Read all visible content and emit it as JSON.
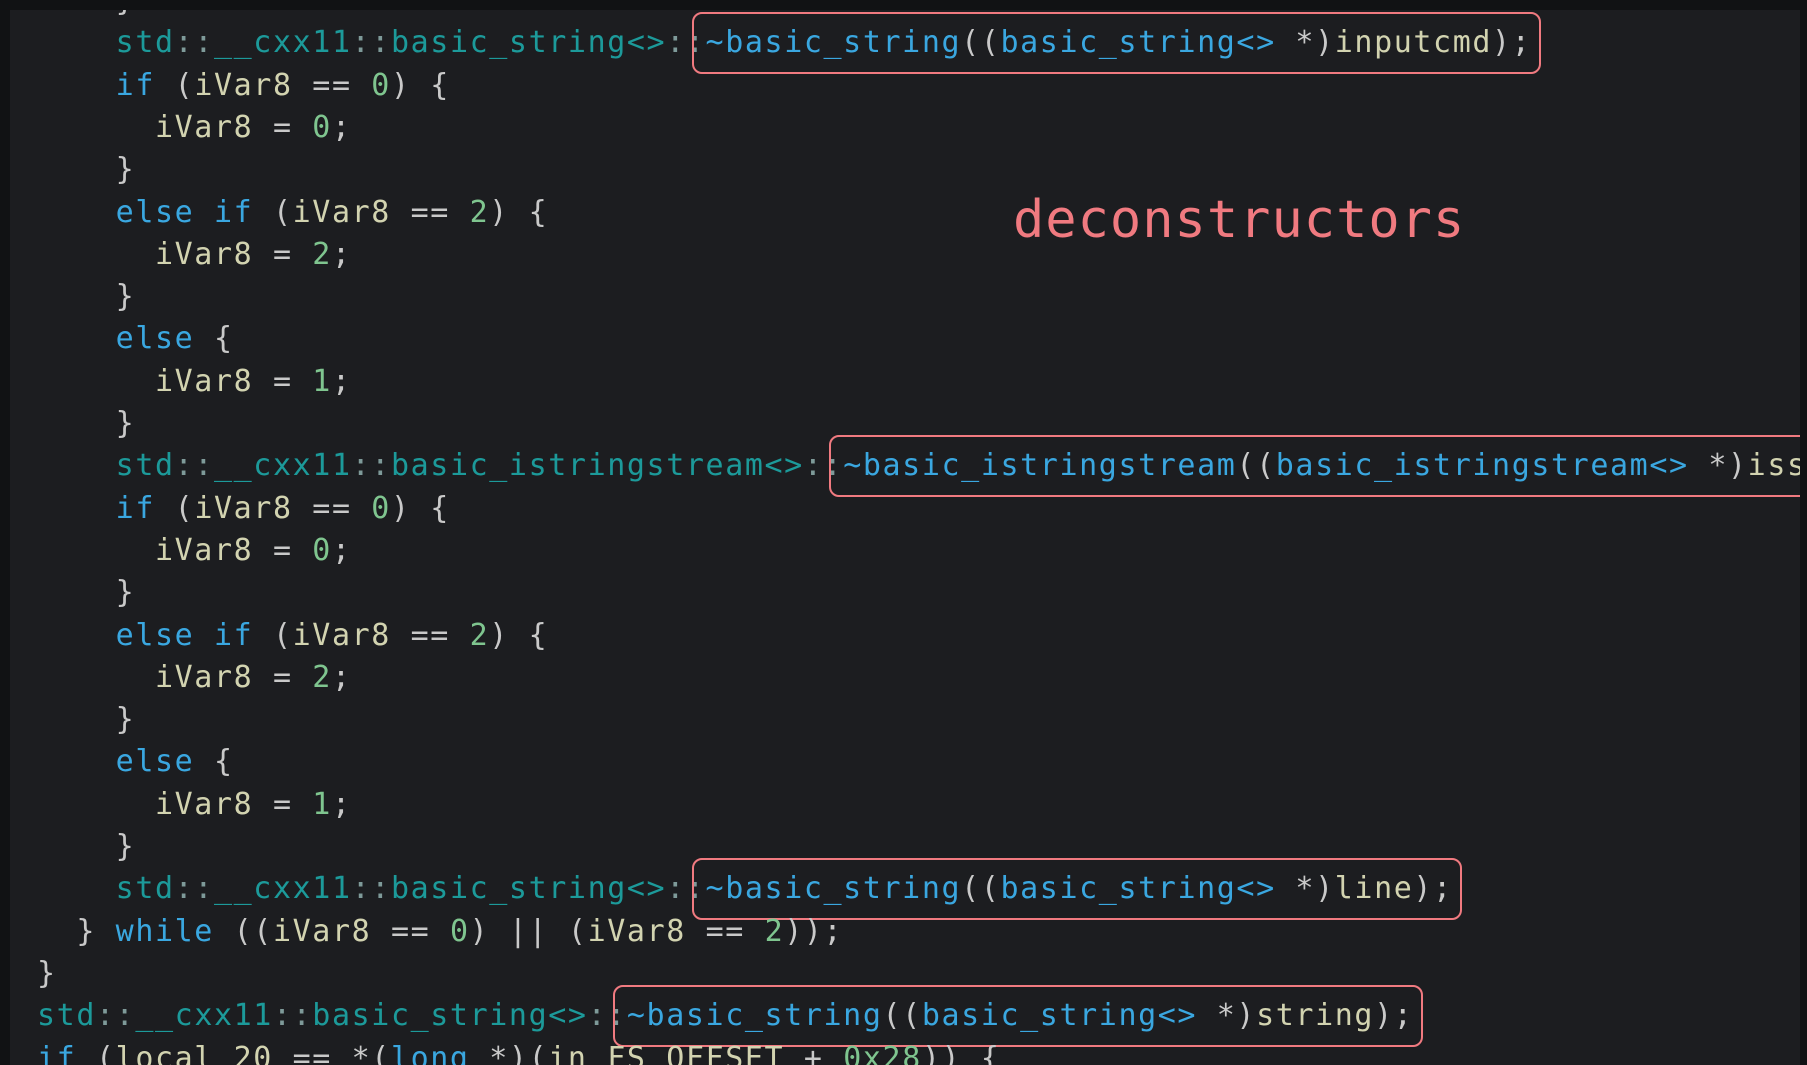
{
  "annotation": "deconstructors",
  "colors": {
    "background": "#1c1d20",
    "keyword": "#3aa7e0",
    "identifier": "#d2d3b0",
    "number": "#7fc58f",
    "class": "#1c9a9a",
    "highlight": "#f07a80"
  },
  "lines": [
    {
      "indent": "    ",
      "tokens": [
        {
          "t": "}",
          "c": "p"
        }
      ]
    },
    {
      "indent": "    ",
      "hl": true,
      "tokens": [
        {
          "t": "std",
          "c": "cls"
        },
        {
          "t": "::",
          "c": "op"
        },
        {
          "t": "__cxx11",
          "c": "cls"
        },
        {
          "t": "::",
          "c": "op"
        },
        {
          "t": "basic_string<>",
          "c": "cls"
        },
        {
          "t": "::",
          "c": "op"
        },
        {
          "t": "~basic_string",
          "c": "kw"
        },
        {
          "t": "((",
          "c": "p"
        },
        {
          "t": "basic_string<>",
          "c": "kw"
        },
        {
          "t": " *)",
          "c": "p"
        },
        {
          "t": "inputcmd",
          "c": "id"
        },
        {
          "t": ");",
          "c": "p"
        }
      ]
    },
    {
      "indent": "    ",
      "tokens": [
        {
          "t": "if",
          "c": "kw"
        },
        {
          "t": " (",
          "c": "p"
        },
        {
          "t": "iVar8",
          "c": "id"
        },
        {
          "t": " == ",
          "c": "p"
        },
        {
          "t": "0",
          "c": "num"
        },
        {
          "t": ") {",
          "c": "p"
        }
      ]
    },
    {
      "indent": "      ",
      "tokens": [
        {
          "t": "iVar8",
          "c": "id"
        },
        {
          "t": " = ",
          "c": "p"
        },
        {
          "t": "0",
          "c": "num"
        },
        {
          "t": ";",
          "c": "p"
        }
      ]
    },
    {
      "indent": "    ",
      "tokens": [
        {
          "t": "}",
          "c": "p"
        }
      ]
    },
    {
      "indent": "    ",
      "tokens": [
        {
          "t": "else if",
          "c": "kw"
        },
        {
          "t": " (",
          "c": "p"
        },
        {
          "t": "iVar8",
          "c": "id"
        },
        {
          "t": " == ",
          "c": "p"
        },
        {
          "t": "2",
          "c": "num"
        },
        {
          "t": ") {",
          "c": "p"
        }
      ]
    },
    {
      "indent": "      ",
      "tokens": [
        {
          "t": "iVar8",
          "c": "id"
        },
        {
          "t": " = ",
          "c": "p"
        },
        {
          "t": "2",
          "c": "num"
        },
        {
          "t": ";",
          "c": "p"
        }
      ]
    },
    {
      "indent": "    ",
      "tokens": [
        {
          "t": "}",
          "c": "p"
        }
      ]
    },
    {
      "indent": "    ",
      "tokens": [
        {
          "t": "else",
          "c": "kw"
        },
        {
          "t": " {",
          "c": "p"
        }
      ]
    },
    {
      "indent": "      ",
      "tokens": [
        {
          "t": "iVar8",
          "c": "id"
        },
        {
          "t": " = ",
          "c": "p"
        },
        {
          "t": "1",
          "c": "num"
        },
        {
          "t": ";",
          "c": "p"
        }
      ]
    },
    {
      "indent": "    ",
      "tokens": [
        {
          "t": "}",
          "c": "p"
        }
      ]
    },
    {
      "indent": "    ",
      "hl": true,
      "tokens": [
        {
          "t": "std",
          "c": "cls"
        },
        {
          "t": "::",
          "c": "op"
        },
        {
          "t": "__cxx11",
          "c": "cls"
        },
        {
          "t": "::",
          "c": "op"
        },
        {
          "t": "basic_istringstream<>",
          "c": "cls"
        },
        {
          "t": "::",
          "c": "op"
        },
        {
          "t": "~basic_istringstream",
          "c": "kw"
        },
        {
          "t": "((",
          "c": "p"
        },
        {
          "t": "basic_istringstream<>",
          "c": "kw"
        },
        {
          "t": " *)",
          "c": "p"
        },
        {
          "t": "iss",
          "c": "id"
        },
        {
          "t": ");",
          "c": "p"
        }
      ]
    },
    {
      "indent": "    ",
      "tokens": [
        {
          "t": "if",
          "c": "kw"
        },
        {
          "t": " (",
          "c": "p"
        },
        {
          "t": "iVar8",
          "c": "id"
        },
        {
          "t": " == ",
          "c": "p"
        },
        {
          "t": "0",
          "c": "num"
        },
        {
          "t": ") {",
          "c": "p"
        }
      ]
    },
    {
      "indent": "      ",
      "tokens": [
        {
          "t": "iVar8",
          "c": "id"
        },
        {
          "t": " = ",
          "c": "p"
        },
        {
          "t": "0",
          "c": "num"
        },
        {
          "t": ";",
          "c": "p"
        }
      ]
    },
    {
      "indent": "    ",
      "tokens": [
        {
          "t": "}",
          "c": "p"
        }
      ]
    },
    {
      "indent": "    ",
      "tokens": [
        {
          "t": "else if",
          "c": "kw"
        },
        {
          "t": " (",
          "c": "p"
        },
        {
          "t": "iVar8",
          "c": "id"
        },
        {
          "t": " == ",
          "c": "p"
        },
        {
          "t": "2",
          "c": "num"
        },
        {
          "t": ") {",
          "c": "p"
        }
      ]
    },
    {
      "indent": "      ",
      "tokens": [
        {
          "t": "iVar8",
          "c": "id"
        },
        {
          "t": " = ",
          "c": "p"
        },
        {
          "t": "2",
          "c": "num"
        },
        {
          "t": ";",
          "c": "p"
        }
      ]
    },
    {
      "indent": "    ",
      "tokens": [
        {
          "t": "}",
          "c": "p"
        }
      ]
    },
    {
      "indent": "    ",
      "tokens": [
        {
          "t": "else",
          "c": "kw"
        },
        {
          "t": " {",
          "c": "p"
        }
      ]
    },
    {
      "indent": "      ",
      "tokens": [
        {
          "t": "iVar8",
          "c": "id"
        },
        {
          "t": " = ",
          "c": "p"
        },
        {
          "t": "1",
          "c": "num"
        },
        {
          "t": ";",
          "c": "p"
        }
      ]
    },
    {
      "indent": "    ",
      "tokens": [
        {
          "t": "}",
          "c": "p"
        }
      ]
    },
    {
      "indent": "    ",
      "hl": true,
      "tokens": [
        {
          "t": "std",
          "c": "cls"
        },
        {
          "t": "::",
          "c": "op"
        },
        {
          "t": "__cxx11",
          "c": "cls"
        },
        {
          "t": "::",
          "c": "op"
        },
        {
          "t": "basic_string<>",
          "c": "cls"
        },
        {
          "t": "::",
          "c": "op"
        },
        {
          "t": "~basic_string",
          "c": "kw"
        },
        {
          "t": "((",
          "c": "p"
        },
        {
          "t": "basic_string<>",
          "c": "kw"
        },
        {
          "t": " *)",
          "c": "p"
        },
        {
          "t": "line",
          "c": "id"
        },
        {
          "t": ");",
          "c": "p"
        }
      ]
    },
    {
      "indent": "  ",
      "tokens": [
        {
          "t": "} ",
          "c": "p"
        },
        {
          "t": "while",
          "c": "kw"
        },
        {
          "t": " ((",
          "c": "p"
        },
        {
          "t": "iVar8",
          "c": "id"
        },
        {
          "t": " == ",
          "c": "p"
        },
        {
          "t": "0",
          "c": "num"
        },
        {
          "t": ") || (",
          "c": "p"
        },
        {
          "t": "iVar8",
          "c": "id"
        },
        {
          "t": " == ",
          "c": "p"
        },
        {
          "t": "2",
          "c": "num"
        },
        {
          "t": "));",
          "c": "p"
        }
      ]
    },
    {
      "indent": "",
      "tokens": [
        {
          "t": "}",
          "c": "p"
        }
      ]
    },
    {
      "indent": "",
      "hl": true,
      "tokens": [
        {
          "t": "std",
          "c": "cls"
        },
        {
          "t": "::",
          "c": "op"
        },
        {
          "t": "__cxx11",
          "c": "cls"
        },
        {
          "t": "::",
          "c": "op"
        },
        {
          "t": "basic_string<>",
          "c": "cls"
        },
        {
          "t": "::",
          "c": "op"
        },
        {
          "t": "~basic_string",
          "c": "kw"
        },
        {
          "t": "((",
          "c": "p"
        },
        {
          "t": "basic_string<>",
          "c": "kw"
        },
        {
          "t": " *)",
          "c": "p"
        },
        {
          "t": "string",
          "c": "id"
        },
        {
          "t": ");",
          "c": "p"
        }
      ]
    },
    {
      "indent": "",
      "tokens": [
        {
          "t": "if",
          "c": "kw"
        },
        {
          "t": " (",
          "c": "p"
        },
        {
          "t": "local_20",
          "c": "id"
        },
        {
          "t": " == *(",
          "c": "p"
        },
        {
          "t": "long",
          "c": "kw"
        },
        {
          "t": " *)(",
          "c": "p"
        },
        {
          "t": "in_FS_OFFSET",
          "c": "id"
        },
        {
          "t": " + ",
          "c": "p"
        },
        {
          "t": "0x28",
          "c": "num"
        },
        {
          "t": ")) {",
          "c": "p"
        }
      ]
    }
  ]
}
